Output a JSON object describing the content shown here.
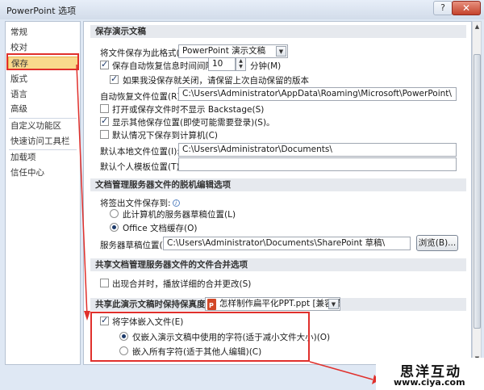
{
  "window": {
    "title": "PowerPoint 选项",
    "help": "?",
    "close": "✕"
  },
  "sidebar": {
    "items": [
      "常规",
      "校对",
      "保存",
      "版式",
      "语言",
      "高级",
      "自定义功能区",
      "快速访问工具栏",
      "加载项",
      "信任中心"
    ],
    "active_index": 2
  },
  "save": {
    "header": "保存演示文稿",
    "format_label": "将文件保存为此格式(F):",
    "format_value": "PowerPoint 演示文稿",
    "autorecover_label": "保存自动恢复信息时间间隔(A)",
    "autorecover_checked": true,
    "interval_value": "10",
    "minutes_label": "分钟(M)",
    "keep_last_label": "如果我没保存就关闭，请保留上次自动保留的版本",
    "keep_last_checked": true,
    "autorecover_loc_label": "自动恢复文件位置(R):",
    "autorecover_loc_value": "C:\\Users\\Administrator\\AppData\\Roaming\\Microsoft\\PowerPoint\\",
    "no_backstage_label": "打开或保存文件时不显示 Backstage(S)",
    "no_backstage_checked": false,
    "show_extra_label": "显示其他保存位置(即使可能需要登录)(S)。",
    "show_extra_checked": true,
    "default_computer_label": "默认情况下保存到计算机(C)",
    "default_computer_checked": false,
    "default_loc_label": "默认本地文件位置(I):",
    "default_loc_value": "C:\\Users\\Administrator\\Documents\\",
    "templates_label": "默认个人模板位置(T):",
    "templates_value": ""
  },
  "offline": {
    "header": "文档管理服务器文件的脱机编辑选项",
    "saveto_label": "将签出文件保存到:",
    "opt_server": "此计算机的服务器草稿位置(L)",
    "opt_server_checked": false,
    "opt_cache": "Office 文档缓存(O)",
    "opt_cache_checked": true,
    "drafts_label": "服务器草稿位置(V):",
    "drafts_value": "C:\\Users\\Administrator\\Documents\\SharePoint 草稿\\",
    "browse": "浏览(B)..."
  },
  "merge": {
    "header": "共享文档管理服务器文件的文件合并选项",
    "details_label": "出现合并时，播放详细的合并更改(S)",
    "details_checked": false
  },
  "fidelity": {
    "header_label": "共享此演示文稿时保持保真度(D):",
    "file_value": "怎样制作扁平化PPT.ppt [兼容模式]",
    "embed_label": "将字体嵌入文件(E)",
    "embed_checked": true,
    "opt_used": "仅嵌入演示文稿中使用的字符(适于减小文件大小)(O)",
    "opt_used_checked": true,
    "opt_all": "嵌入所有字符(适于其他人编辑)(C)",
    "opt_all_checked": false
  },
  "brand": {
    "name": "思洋互动",
    "url": "www.ciya.com"
  },
  "colors": {
    "accent_red": "#e0302c",
    "active_bg": "#f9d98c"
  }
}
